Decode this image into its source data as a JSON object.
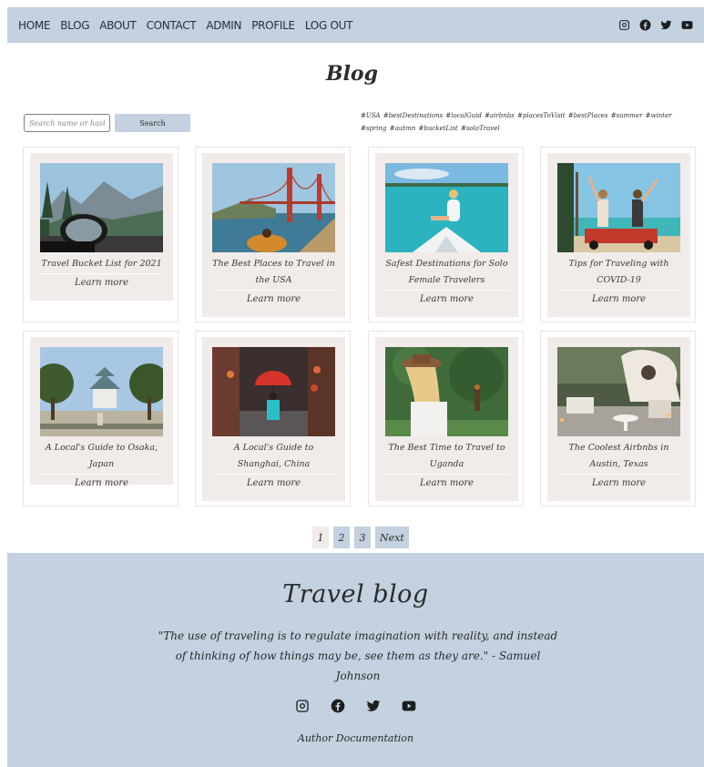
{
  "nav": {
    "links": [
      "HOME",
      "BLOG",
      "ABOUT",
      "CONTACT",
      "ADMIN",
      "PROFILE",
      "LOG OUT"
    ],
    "social_icons": [
      "instagram-icon",
      "facebook-icon",
      "twitter-icon",
      "youtube-icon"
    ]
  },
  "page": {
    "title": "Blog"
  },
  "search": {
    "placeholder": "Search name or hastag",
    "button_label": "Search"
  },
  "hashtags": "#USA #bestDestinations #localGuid #airbnbs #placesToVisit #bestPlaces #summer #winter #spring #autmn #bucketList #soloTravel",
  "cards": [
    {
      "title": "Travel Bucket List for 2021",
      "link": "Learn more",
      "image": "car-mirror-mountains"
    },
    {
      "title": "The Best Places to Travel in the USA",
      "link": "Learn more",
      "image": "golden-gate-bridge"
    },
    {
      "title": "Safest Destinations for Solo Female Travelers",
      "link": "Learn more",
      "image": "boat-turquoise-sea"
    },
    {
      "title": "Tips for Traveling with COVID-19",
      "link": "Learn more",
      "image": "friends-beach-car"
    },
    {
      "title": "A Local's Guide to Osaka, Japan",
      "link": "Learn more",
      "image": "osaka-castle"
    },
    {
      "title": "A Local's Guide to Shanghai, China",
      "link": "Learn more",
      "image": "red-umbrella-street"
    },
    {
      "title": "The Best Time to Travel to Uganda",
      "link": "Learn more",
      "image": "woman-hat-forest"
    },
    {
      "title": "The Coolest Airbnbs in Austin, Texas",
      "link": "Learn more",
      "image": "airbnb-patio"
    }
  ],
  "pagination": {
    "pages": [
      "1",
      "2",
      "3"
    ],
    "next_label": "Next",
    "current": "1"
  },
  "footer": {
    "title": "Travel blog",
    "quote": "\"The use of traveling is to regulate imagination with reality, and instead of thinking of how things may be, see them as they are.\" - Samuel Johnson",
    "link": "Author Documentation"
  },
  "colors": {
    "accent": "#c3d1e0",
    "card_bg": "#f1ebe9"
  }
}
